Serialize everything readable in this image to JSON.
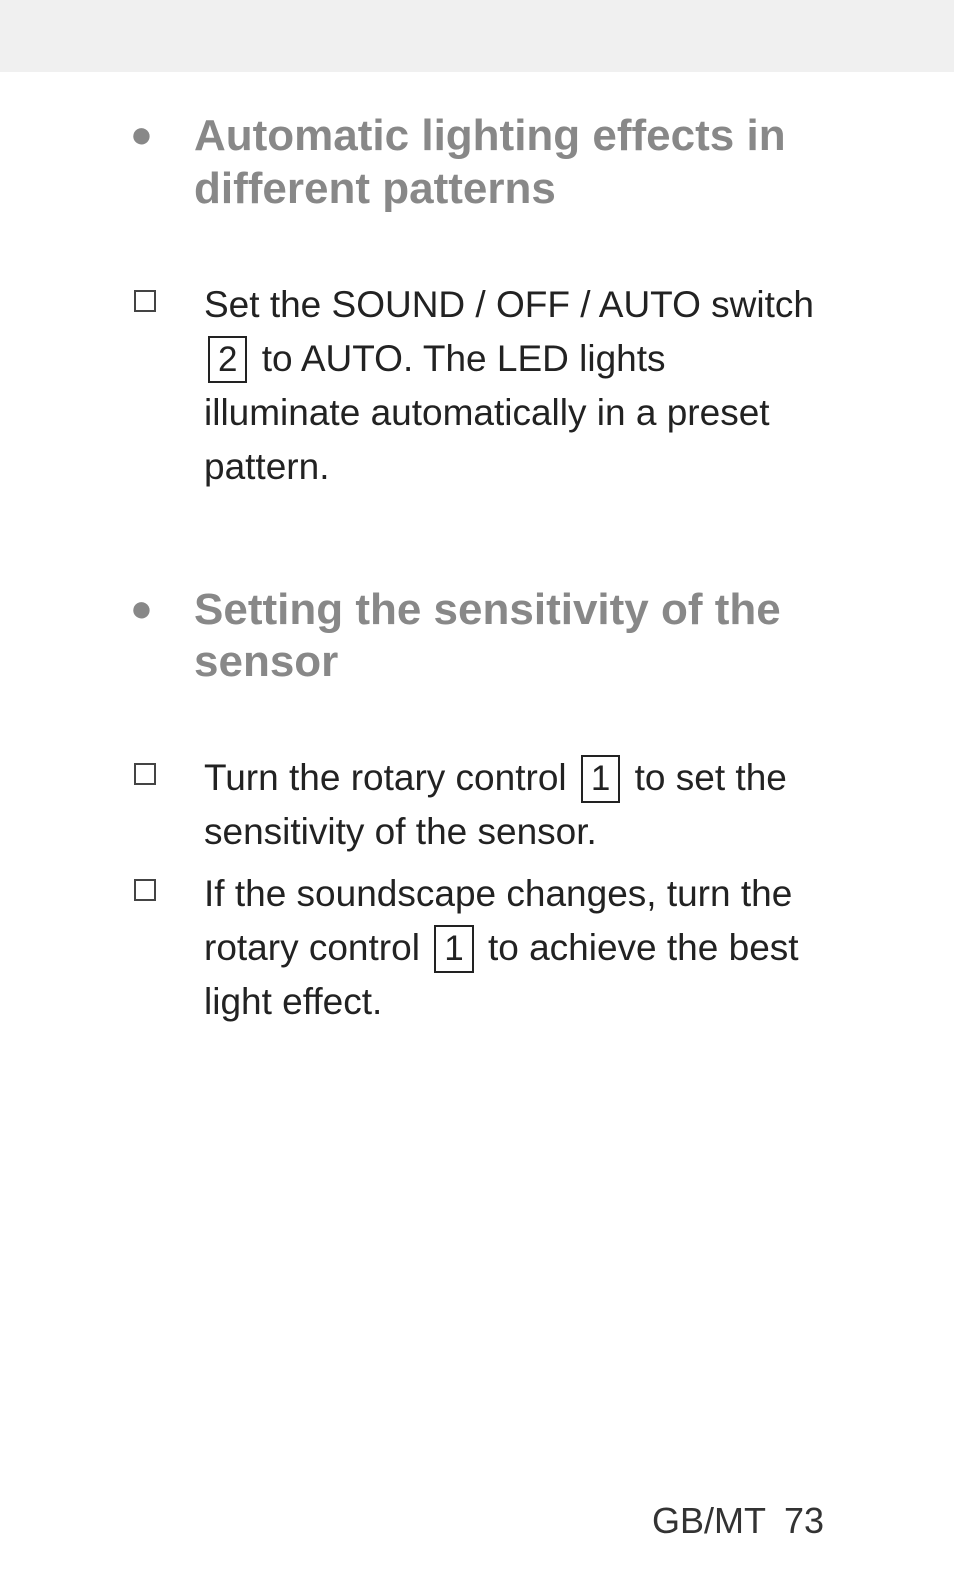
{
  "sections": [
    {
      "heading": "Automatic lighting effects in different patterns",
      "items": [
        {
          "pre1": "Set the SOUND / OFF / AUTO switch ",
          "ref1": "2",
          "mid1": " to AUTO. The LED lights illuminate automatically in a preset pattern.",
          "ref2": "",
          "post": ""
        }
      ]
    },
    {
      "heading": "Setting the sensitivity of the sensor",
      "items": [
        {
          "pre1": "Turn the rotary control ",
          "ref1": "1",
          "mid1": " to set the sensitivity of the sensor.",
          "ref2": "",
          "post": ""
        },
        {
          "pre1": "If the soundscape changes, turn the rotary control ",
          "ref1": "1",
          "mid1": " to achieve the best light effect.",
          "ref2": "",
          "post": ""
        }
      ]
    }
  ],
  "footer": {
    "locale": "GB/MT",
    "page": "73"
  }
}
